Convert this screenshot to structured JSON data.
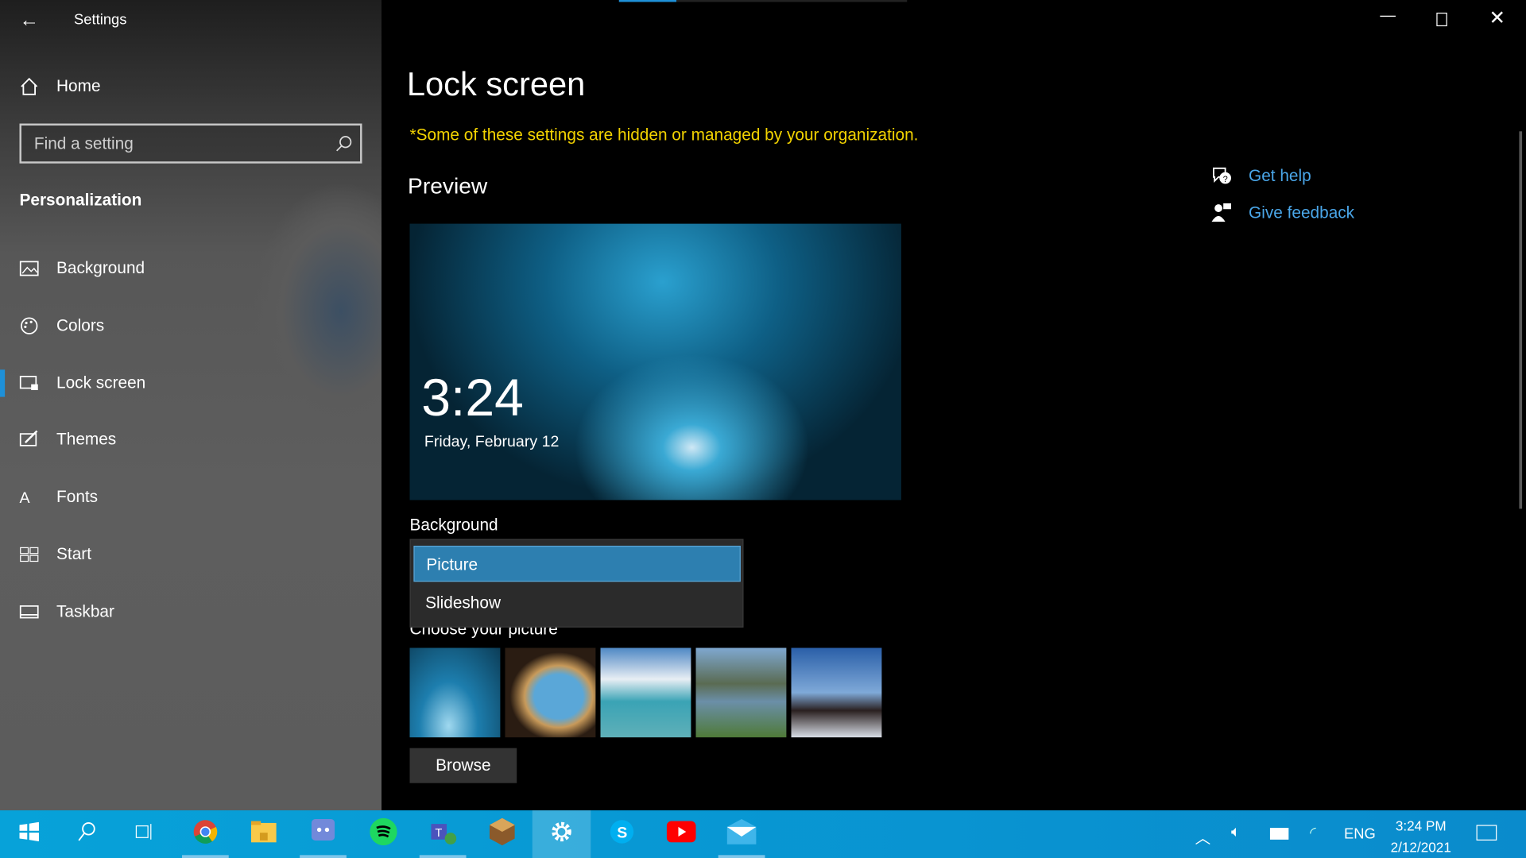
{
  "window": {
    "title": "Settings",
    "progress_percent": 20
  },
  "sidebar": {
    "home": "Home",
    "search_placeholder": "Find a setting",
    "section": "Personalization",
    "items": [
      {
        "label": "Background",
        "icon": "image-icon"
      },
      {
        "label": "Colors",
        "icon": "palette-icon"
      },
      {
        "label": "Lock screen",
        "icon": "lock-screen-icon",
        "selected": true
      },
      {
        "label": "Themes",
        "icon": "themes-icon"
      },
      {
        "label": "Fonts",
        "icon": "fonts-icon"
      },
      {
        "label": "Start",
        "icon": "start-icon"
      },
      {
        "label": "Taskbar",
        "icon": "taskbar-icon"
      }
    ]
  },
  "main": {
    "title": "Lock screen",
    "notice": "*Some of these settings are hidden or managed by your organization.",
    "preview_heading": "Preview",
    "preview_time": "3:24",
    "preview_date": "Friday, February 12",
    "background_label": "Background",
    "dropdown_options": [
      "Picture",
      "Slideshow"
    ],
    "dropdown_selected": "Picture",
    "choose_label": "Choose your picture",
    "browse": "Browse"
  },
  "help": {
    "get_help": "Get help",
    "give_feedback": "Give feedback"
  },
  "colors": {
    "accent": "#2d7fb0",
    "link": "#4aa6e8",
    "notice": "#f2d200",
    "taskbar": "#0a94d4"
  },
  "taskbar": {
    "apps": [
      "windows-start",
      "search",
      "task-view",
      "chrome",
      "file-explorer",
      "discord",
      "spotify",
      "teams",
      "minecraft",
      "settings",
      "skype",
      "youtube",
      "mail"
    ],
    "lang": "ENG",
    "time": "3:24 PM",
    "date": "2/12/2021"
  }
}
